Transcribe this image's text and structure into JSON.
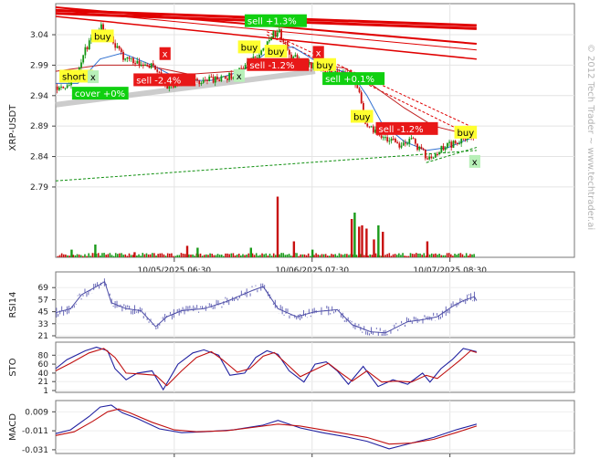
{
  "watermark": "© 2012 Tech Trader ~ www.techtrader.ai",
  "chart_data": [
    {
      "type": "candlestick",
      "name": "price",
      "ylabel": "XRP-USDT",
      "yticks": [
        3.04,
        2.99,
        2.94,
        2.89,
        2.84,
        2.79
      ],
      "ylim": [
        2.715,
        3.085
      ],
      "x_range": [
        0,
        700
      ],
      "xtick_labels": [
        {
          "x": 160,
          "label": "10/05/2025 06:30"
        },
        {
          "x": 346,
          "label": "10/06/2025 07:30"
        },
        {
          "x": 532,
          "label": "10/07/2025 08:30"
        }
      ],
      "price_path": [
        [
          0,
          2.955
        ],
        [
          14,
          2.958
        ],
        [
          26,
          2.972
        ],
        [
          40,
          3.018
        ],
        [
          60,
          3.055
        ],
        [
          72,
          3.04
        ],
        [
          88,
          3.005
        ],
        [
          110,
          2.995
        ],
        [
          130,
          2.99
        ],
        [
          150,
          2.955
        ],
        [
          170,
          2.965
        ],
        [
          190,
          2.962
        ],
        [
          205,
          2.968
        ],
        [
          220,
          2.965
        ],
        [
          240,
          2.975
        ],
        [
          260,
          2.995
        ],
        [
          275,
          3.01
        ],
        [
          288,
          3.038
        ],
        [
          300,
          3.045
        ],
        [
          316,
          3.005
        ],
        [
          340,
          2.99
        ],
        [
          360,
          2.983
        ],
        [
          380,
          2.978
        ],
        [
          398,
          2.972
        ],
        [
          410,
          2.94
        ],
        [
          416,
          2.9
        ],
        [
          428,
          2.88
        ],
        [
          440,
          2.875
        ],
        [
          460,
          2.86
        ],
        [
          480,
          2.865
        ],
        [
          493,
          2.85
        ],
        [
          500,
          2.835
        ],
        [
          520,
          2.855
        ],
        [
          540,
          2.862
        ],
        [
          555,
          2.872
        ],
        [
          560,
          2.875
        ]
      ],
      "ma_fast": [
        [
          0,
          2.96
        ],
        [
          30,
          2.96
        ],
        [
          60,
          3.0
        ],
        [
          90,
          3.01
        ],
        [
          130,
          2.99
        ],
        [
          170,
          2.965
        ],
        [
          210,
          2.965
        ],
        [
          250,
          2.98
        ],
        [
          290,
          3.015
        ],
        [
          320,
          3.02
        ],
        [
          360,
          2.99
        ],
        [
          400,
          2.975
        ],
        [
          420,
          2.94
        ],
        [
          440,
          2.895
        ],
        [
          470,
          2.865
        ],
        [
          500,
          2.85
        ],
        [
          530,
          2.855
        ],
        [
          560,
          2.87
        ]
      ],
      "ma_slow": [
        [
          0,
          2.98
        ],
        [
          60,
          2.99
        ],
        [
          120,
          2.99
        ],
        [
          180,
          2.975
        ],
        [
          240,
          2.98
        ],
        [
          290,
          2.995
        ],
        [
          340,
          2.995
        ],
        [
          390,
          2.985
        ],
        [
          430,
          2.955
        ],
        [
          470,
          2.92
        ],
        [
          510,
          2.89
        ],
        [
          560,
          2.875
        ]
      ],
      "trendlines": [
        {
          "from": [
            0,
            3.08
          ],
          "to": [
            568,
            3.055
          ],
          "color": "#e00000",
          "width": 3
        },
        {
          "from": [
            0,
            3.075
          ],
          "to": [
            568,
            3.05
          ],
          "color": "#e00000",
          "width": 3
        },
        {
          "from": [
            0,
            3.085
          ],
          "to": [
            568,
            3.025
          ],
          "color": "#e00000",
          "width": 2
        },
        {
          "from": [
            0,
            3.07
          ],
          "to": [
            568,
            3.0
          ],
          "color": "#e00000",
          "width": 1.5
        },
        {
          "from": [
            0,
            3.08
          ],
          "to": [
            568,
            3.015
          ],
          "color": "#e00000",
          "width": 1
        },
        {
          "from": [
            285,
            3.045
          ],
          "to": [
            568,
            2.885
          ],
          "color": "#e00000",
          "width": 1,
          "dash": true
        },
        {
          "from": [
            285,
            3.04
          ],
          "to": [
            568,
            2.87
          ],
          "color": "#e00000",
          "width": 1,
          "dash": true
        },
        {
          "from": [
            0,
            2.8
          ],
          "to": [
            568,
            2.85
          ],
          "color": "#109010",
          "width": 1,
          "dash": true
        },
        {
          "from": [
            500,
            2.83
          ],
          "to": [
            568,
            2.855
          ],
          "color": "#109010",
          "width": 1,
          "dash": true
        },
        {
          "from": [
            0,
            2.925
          ],
          "to": [
            350,
            2.98
          ],
          "color": "#c0c0c0",
          "width": 6
        }
      ],
      "signals": [
        {
          "x": 5,
          "y": 2.966,
          "text": "short",
          "kind": "yellow"
        },
        {
          "x": 22,
          "y": 2.938,
          "text": "cover +0%",
          "kind": "green"
        },
        {
          "x": 48,
          "y": 3.032,
          "text": "buy",
          "kind": "yellow"
        },
        {
          "x": 43,
          "y": 2.965,
          "text": "x",
          "kind": "palegreen"
        },
        {
          "x": 140,
          "y": 3.003,
          "text": "x",
          "kind": "red"
        },
        {
          "x": 105,
          "y": 2.96,
          "text": "sell -2.4%",
          "kind": "red"
        },
        {
          "x": 240,
          "y": 2.967,
          "text": "x",
          "kind": "palegreen"
        },
        {
          "x": 255,
          "y": 3.057,
          "text": "sell +1.3%",
          "kind": "green"
        },
        {
          "x": 246,
          "y": 3.014,
          "text": "buy",
          "kind": "yellow"
        },
        {
          "x": 282,
          "y": 3.007,
          "text": "buy",
          "kind": "yellow"
        },
        {
          "x": 258,
          "y": 2.985,
          "text": "sell -1.2%",
          "kind": "red"
        },
        {
          "x": 347,
          "y": 3.005,
          "text": "x",
          "kind": "red"
        },
        {
          "x": 348,
          "y": 2.985,
          "text": "buy",
          "kind": "yellow"
        },
        {
          "x": 360,
          "y": 2.962,
          "text": "sell +0.1%",
          "kind": "green"
        },
        {
          "x": 398,
          "y": 2.9,
          "text": "buy",
          "kind": "yellow"
        },
        {
          "x": 432,
          "y": 2.88,
          "text": "sell -1.2%",
          "kind": "red"
        },
        {
          "x": 538,
          "y": 2.874,
          "text": "buy",
          "kind": "yellow"
        },
        {
          "x": 558,
          "y": 2.826,
          "text": "x",
          "kind": "palegreen"
        }
      ],
      "volume_spikes": [
        {
          "x": 20,
          "v": 0.12,
          "c": "g"
        },
        {
          "x": 52,
          "v": 0.2,
          "c": "g"
        },
        {
          "x": 105,
          "v": 0.08,
          "c": "r"
        },
        {
          "x": 176,
          "v": 0.18,
          "c": "r"
        },
        {
          "x": 190,
          "v": 0.15,
          "c": "g"
        },
        {
          "x": 262,
          "v": 0.15,
          "c": "g"
        },
        {
          "x": 298,
          "v": 0.95,
          "c": "r"
        },
        {
          "x": 320,
          "v": 0.25,
          "c": "r"
        },
        {
          "x": 345,
          "v": 0.12,
          "c": "g"
        },
        {
          "x": 398,
          "v": 0.6,
          "c": "r"
        },
        {
          "x": 402,
          "v": 0.7,
          "c": "g"
        },
        {
          "x": 408,
          "v": 0.48,
          "c": "r"
        },
        {
          "x": 412,
          "v": 0.5,
          "c": "r"
        },
        {
          "x": 418,
          "v": 0.45,
          "c": "r"
        },
        {
          "x": 428,
          "v": 0.28,
          "c": "r"
        },
        {
          "x": 434,
          "v": 0.5,
          "c": "g"
        },
        {
          "x": 440,
          "v": 0.4,
          "c": "r"
        },
        {
          "x": 500,
          "v": 0.25,
          "c": "r"
        }
      ]
    },
    {
      "type": "line",
      "name": "rsi",
      "ylabel": "RSI14",
      "yticks": [
        69,
        57,
        45,
        33,
        21
      ],
      "ylim": [
        21,
        81
      ],
      "points": [
        [
          0,
          44
        ],
        [
          20,
          48
        ],
        [
          35,
          62
        ],
        [
          55,
          70
        ],
        [
          66,
          75
        ],
        [
          75,
          54
        ],
        [
          95,
          48
        ],
        [
          115,
          46
        ],
        [
          135,
          30
        ],
        [
          150,
          40
        ],
        [
          170,
          46
        ],
        [
          200,
          48
        ],
        [
          230,
          55
        ],
        [
          265,
          66
        ],
        [
          280,
          70
        ],
        [
          300,
          48
        ],
        [
          325,
          40
        ],
        [
          350,
          45
        ],
        [
          380,
          47
        ],
        [
          400,
          32
        ],
        [
          425,
          25
        ],
        [
          445,
          24
        ],
        [
          475,
          35
        ],
        [
          495,
          37
        ],
        [
          515,
          40
        ],
        [
          535,
          50
        ],
        [
          550,
          56
        ],
        [
          565,
          60
        ],
        [
          568,
          56
        ]
      ]
    },
    {
      "type": "line",
      "name": "stochastic",
      "ylabel": "STO",
      "yticks": [
        80,
        60,
        40,
        21,
        1
      ],
      "ylim": [
        1,
        101
      ],
      "series": [
        {
          "color": "#2020a0",
          "points": [
            [
              0,
              50
            ],
            [
              15,
              70
            ],
            [
              40,
              90
            ],
            [
              55,
              98
            ],
            [
              70,
              90
            ],
            [
              80,
              50
            ],
            [
              95,
              25
            ],
            [
              110,
              40
            ],
            [
              130,
              45
            ],
            [
              145,
              3
            ],
            [
              165,
              60
            ],
            [
              185,
              85
            ],
            [
              200,
              92
            ],
            [
              220,
              80
            ],
            [
              235,
              35
            ],
            [
              255,
              40
            ],
            [
              270,
              75
            ],
            [
              285,
              90
            ],
            [
              300,
              82
            ],
            [
              315,
              45
            ],
            [
              335,
              20
            ],
            [
              350,
              60
            ],
            [
              365,
              65
            ],
            [
              380,
              45
            ],
            [
              395,
              15
            ],
            [
              415,
              55
            ],
            [
              435,
              10
            ],
            [
              455,
              25
            ],
            [
              475,
              15
            ],
            [
              495,
              40
            ],
            [
              505,
              20
            ],
            [
              520,
              50
            ],
            [
              535,
              70
            ],
            [
              550,
              95
            ],
            [
              568,
              88
            ]
          ]
        },
        {
          "color": "#c01010",
          "points": [
            [
              0,
              45
            ],
            [
              20,
              62
            ],
            [
              45,
              85
            ],
            [
              65,
              95
            ],
            [
              80,
              75
            ],
            [
              95,
              40
            ],
            [
              115,
              38
            ],
            [
              135,
              35
            ],
            [
              150,
              12
            ],
            [
              170,
              45
            ],
            [
              190,
              75
            ],
            [
              210,
              88
            ],
            [
              225,
              70
            ],
            [
              245,
              42
            ],
            [
              262,
              50
            ],
            [
              280,
              78
            ],
            [
              295,
              86
            ],
            [
              312,
              60
            ],
            [
              330,
              32
            ],
            [
              350,
              48
            ],
            [
              368,
              62
            ],
            [
              385,
              40
            ],
            [
              400,
              22
            ],
            [
              420,
              45
            ],
            [
              440,
              20
            ],
            [
              460,
              22
            ],
            [
              480,
              20
            ],
            [
              500,
              35
            ],
            [
              515,
              28
            ],
            [
              530,
              48
            ],
            [
              545,
              68
            ],
            [
              560,
              90
            ],
            [
              568,
              86
            ]
          ]
        }
      ]
    },
    {
      "type": "line",
      "name": "macd",
      "ylabel": "MACD",
      "yticks": [
        0.009,
        -0.011,
        -0.031
      ],
      "ylim": [
        -0.033,
        0.017
      ],
      "series": [
        {
          "color": "#2020a0",
          "points": [
            [
              0,
              -0.014
            ],
            [
              20,
              -0.01
            ],
            [
              45,
              0.004
            ],
            [
              60,
              0.014
            ],
            [
              75,
              0.016
            ],
            [
              90,
              0.008
            ],
            [
              110,
              0.002
            ],
            [
              140,
              -0.009
            ],
            [
              170,
              -0.013
            ],
            [
              200,
              -0.012
            ],
            [
              240,
              -0.01
            ],
            [
              280,
              -0.005
            ],
            [
              300,
              0.0
            ],
            [
              330,
              -0.008
            ],
            [
              360,
              -0.013
            ],
            [
              390,
              -0.017
            ],
            [
              420,
              -0.022
            ],
            [
              450,
              -0.03
            ],
            [
              480,
              -0.024
            ],
            [
              510,
              -0.018
            ],
            [
              540,
              -0.01
            ],
            [
              568,
              -0.004
            ]
          ]
        },
        {
          "color": "#c01010",
          "points": [
            [
              0,
              -0.016
            ],
            [
              25,
              -0.012
            ],
            [
              50,
              -0.001
            ],
            [
              70,
              0.009
            ],
            [
              85,
              0.012
            ],
            [
              100,
              0.008
            ],
            [
              130,
              -0.002
            ],
            [
              160,
              -0.01
            ],
            [
              190,
              -0.012
            ],
            [
              230,
              -0.011
            ],
            [
              270,
              -0.007
            ],
            [
              300,
              -0.004
            ],
            [
              330,
              -0.006
            ],
            [
              360,
              -0.01
            ],
            [
              390,
              -0.014
            ],
            [
              420,
              -0.018
            ],
            [
              450,
              -0.025
            ],
            [
              480,
              -0.024
            ],
            [
              510,
              -0.02
            ],
            [
              540,
              -0.013
            ],
            [
              568,
              -0.006
            ]
          ]
        }
      ]
    }
  ]
}
